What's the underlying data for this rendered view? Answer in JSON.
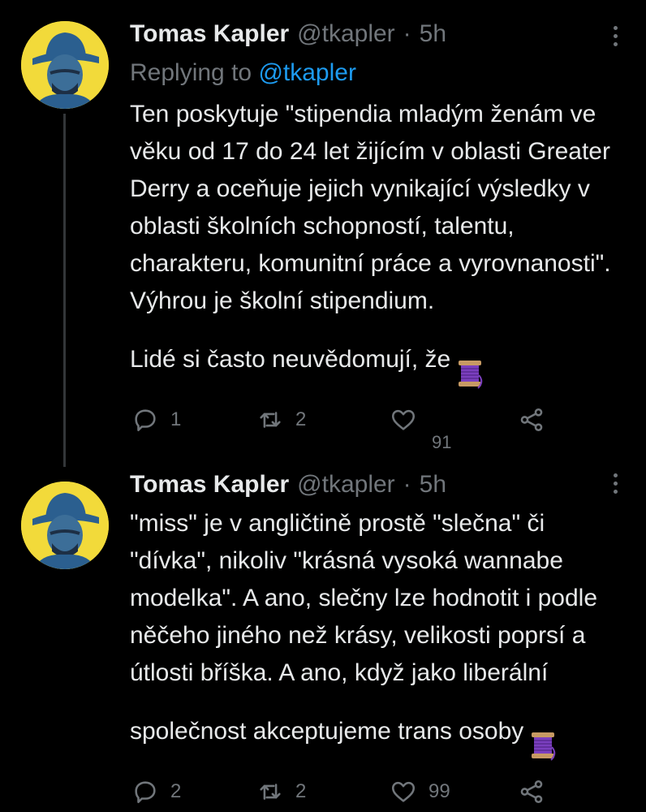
{
  "tweets": [
    {
      "author_name": "Tomas Kapler",
      "author_handle": "@tkapler",
      "separator": "·",
      "time": "5h",
      "replying_prefix": "Replying to ",
      "replying_handle": "@tkapler",
      "text": "Ten poskytuje \"stipendia mladým ženám ve věku od 17 do 24 let žijícím v oblasti Greater Derry a oceňuje jejich vynikající výsledky v oblasti školních schopností, talentu, charakteru, komunitní práce a vyrovnanosti\". Výhrou je školní stipendium.\nLidé si často neuvědomují, že",
      "emoji": "thread-spool",
      "reply_count": "1",
      "retweet_count": "2",
      "like_count": "91"
    },
    {
      "author_name": "Tomas Kapler",
      "author_handle": "@tkapler",
      "separator": "·",
      "time": "5h",
      "text": "\"miss\" je v angličtině prostě \"slečna\" či \"dívka\", nikoliv \"krásná vysoká wannabe modelka\". A ano, slečny lze hodnotit i podle něčeho jiného než krásy, velikosti poprsí a útlosti bříška. A ano, když jako liberální společnost akceptujeme trans osoby",
      "emoji": "thread-spool",
      "reply_count": "2",
      "retweet_count": "2",
      "like_count": "99"
    }
  ],
  "icons": {
    "reply": "reply-icon",
    "retweet": "retweet-icon",
    "like": "heart-icon",
    "share": "share-icon",
    "more": "more-icon"
  },
  "colors": {
    "background": "#000000",
    "text": "#e7e9ea",
    "muted": "#71767b",
    "link": "#1d9bf0",
    "avatar_bg": "#f2da3a",
    "avatar_fg": "#2b5f8f"
  }
}
